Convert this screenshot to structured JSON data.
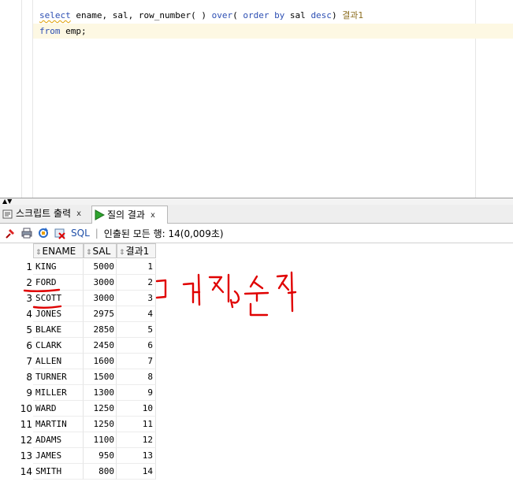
{
  "editor": {
    "line1": {
      "kw_select": "select",
      "part1": " ename, sal, ",
      "fn": "row_number",
      "part2": "( ) ",
      "kw_over": "over",
      "part3": "( ",
      "kw_order_by": "order by",
      "part4": " sal ",
      "kw_desc": "desc",
      "part5": ") ",
      "alias": "결과1"
    },
    "line2": {
      "kw_from": "from",
      "rest": " emp;"
    }
  },
  "tabs": [
    {
      "label": "스크립트 출력",
      "close": "x",
      "icon": "script-output-icon"
    },
    {
      "label": "질의 결과",
      "close": "x",
      "icon": "run-arrow-icon"
    }
  ],
  "toolbar": {
    "sql_label": "SQL",
    "separator": "|",
    "status": "인출된 모든 행: 14(0,009초)"
  },
  "grid": {
    "columns": [
      "ENAME",
      "SAL",
      "결과1"
    ],
    "rows": [
      {
        "num": "1",
        "ename": "KING",
        "sal": "5000",
        "r": "1"
      },
      {
        "num": "2",
        "ename": "FORD",
        "sal": "3000",
        "r": "2"
      },
      {
        "num": "3",
        "ename": "SCOTT",
        "sal": "3000",
        "r": "3"
      },
      {
        "num": "4",
        "ename": "JONES",
        "sal": "2975",
        "r": "4"
      },
      {
        "num": "5",
        "ename": "BLAKE",
        "sal": "2850",
        "r": "5"
      },
      {
        "num": "6",
        "ename": "CLARK",
        "sal": "2450",
        "r": "6"
      },
      {
        "num": "7",
        "ename": "ALLEN",
        "sal": "1600",
        "r": "7"
      },
      {
        "num": "8",
        "ename": "TURNER",
        "sal": "1500",
        "r": "8"
      },
      {
        "num": "9",
        "ename": "MILLER",
        "sal": "1300",
        "r": "9"
      },
      {
        "num": "10",
        "ename": "WARD",
        "sal": "1250",
        "r": "10"
      },
      {
        "num": "11",
        "ename": "MARTIN",
        "sal": "1250",
        "r": "11"
      },
      {
        "num": "12",
        "ename": "ADAMS",
        "sal": "1100",
        "r": "12"
      },
      {
        "num": "13",
        "ename": "JAMES",
        "sal": "950",
        "r": "13"
      },
      {
        "num": "14",
        "ename": "SMITH",
        "sal": "800",
        "r": "14"
      }
    ]
  },
  "colors": {
    "keyword": "#2d4fb3",
    "alias": "#8c6d1f",
    "annotation": "#e00000"
  }
}
